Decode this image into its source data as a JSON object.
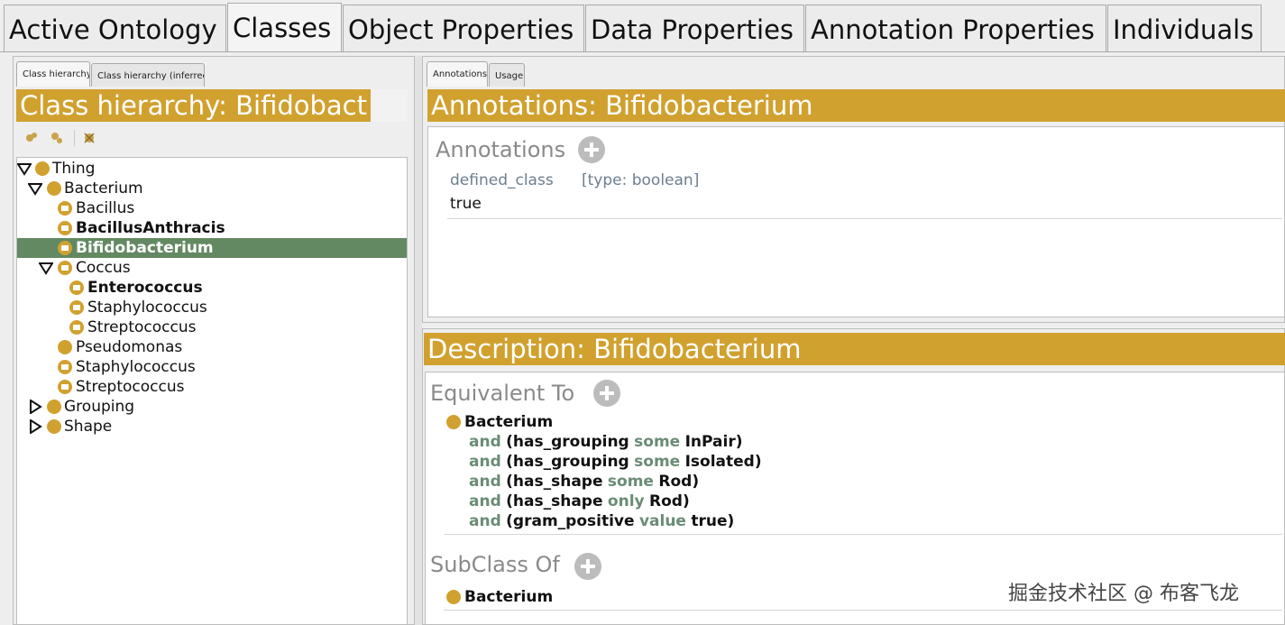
{
  "main_tabs": [
    "Active Ontology",
    "Classes",
    "Object Properties",
    "Data Properties",
    "Annotation Properties",
    "Individuals"
  ],
  "selected_main_tab": "Classes",
  "left_panel": {
    "tabs": [
      "Class hierarchy",
      "Class hierarchy (inferred)"
    ],
    "header": "Class hierarchy: Bifidobact",
    "tree": [
      {
        "label": "Thing",
        "level": 0,
        "expanded": true,
        "bold": false,
        "defined": false
      },
      {
        "label": "Bacterium",
        "level": 1,
        "expanded": true,
        "bold": false,
        "defined": false
      },
      {
        "label": "Bacillus",
        "level": 2,
        "bold": false,
        "defined": true
      },
      {
        "label": "BacillusAnthracis",
        "level": 2,
        "bold": true,
        "defined": true
      },
      {
        "label": "Bifidobacterium",
        "level": 2,
        "bold": true,
        "defined": true,
        "selected": true
      },
      {
        "label": "Coccus",
        "level": 2,
        "expanded": true,
        "bold": false,
        "defined": true
      },
      {
        "label": "Enterococcus",
        "level": 3,
        "bold": true,
        "defined": true
      },
      {
        "label": "Staphylococcus",
        "level": 3,
        "bold": false,
        "defined": true
      },
      {
        "label": "Streptococcus",
        "level": 3,
        "bold": false,
        "defined": true
      },
      {
        "label": "Pseudomonas",
        "level": 2,
        "bold": false,
        "defined": false
      },
      {
        "label": "Staphylococcus",
        "level": 2,
        "bold": false,
        "defined": true
      },
      {
        "label": "Streptococcus",
        "level": 2,
        "bold": false,
        "defined": true
      },
      {
        "label": "Grouping",
        "level": 1,
        "collapsed": true,
        "bold": false,
        "defined": false
      },
      {
        "label": "Shape",
        "level": 1,
        "collapsed": true,
        "bold": false,
        "defined": false
      }
    ]
  },
  "annotations_panel": {
    "tabs": [
      "Annotations",
      "Usage"
    ],
    "header": "Annotations: Bifidobacterium",
    "section_title": "Annotations",
    "property": "defined_class",
    "type": "[type: boolean]",
    "value": "true"
  },
  "description_panel": {
    "header": "Description: Bifidobacterium",
    "equivalent_title": "Equivalent To",
    "equivalent_class": "Bacterium",
    "equivalent_lines": [
      {
        "kw1": "and",
        "pre": "(has_grouping",
        "kw2": "some",
        "post": "InPair)"
      },
      {
        "kw1": "and",
        "pre": "(has_grouping",
        "kw2": "some",
        "post": "Isolated)"
      },
      {
        "kw1": "and",
        "pre": "(has_shape",
        "kw2": "some",
        "post": "Rod)"
      },
      {
        "kw1": "and",
        "pre": "(has_shape",
        "kw2": "only",
        "post": "Rod)"
      },
      {
        "kw1": "and",
        "pre": "(gram_positive",
        "kw2": "value",
        "post": "true)"
      }
    ],
    "subclass_title": "SubClass Of",
    "subclass_class": "Bacterium"
  },
  "watermark": "掘金技术社区 @ 布客飞龙",
  "colors": {
    "header_gold": "#d1a12f",
    "selection_green": "#638963",
    "keyword_green": "#6a8c75"
  }
}
